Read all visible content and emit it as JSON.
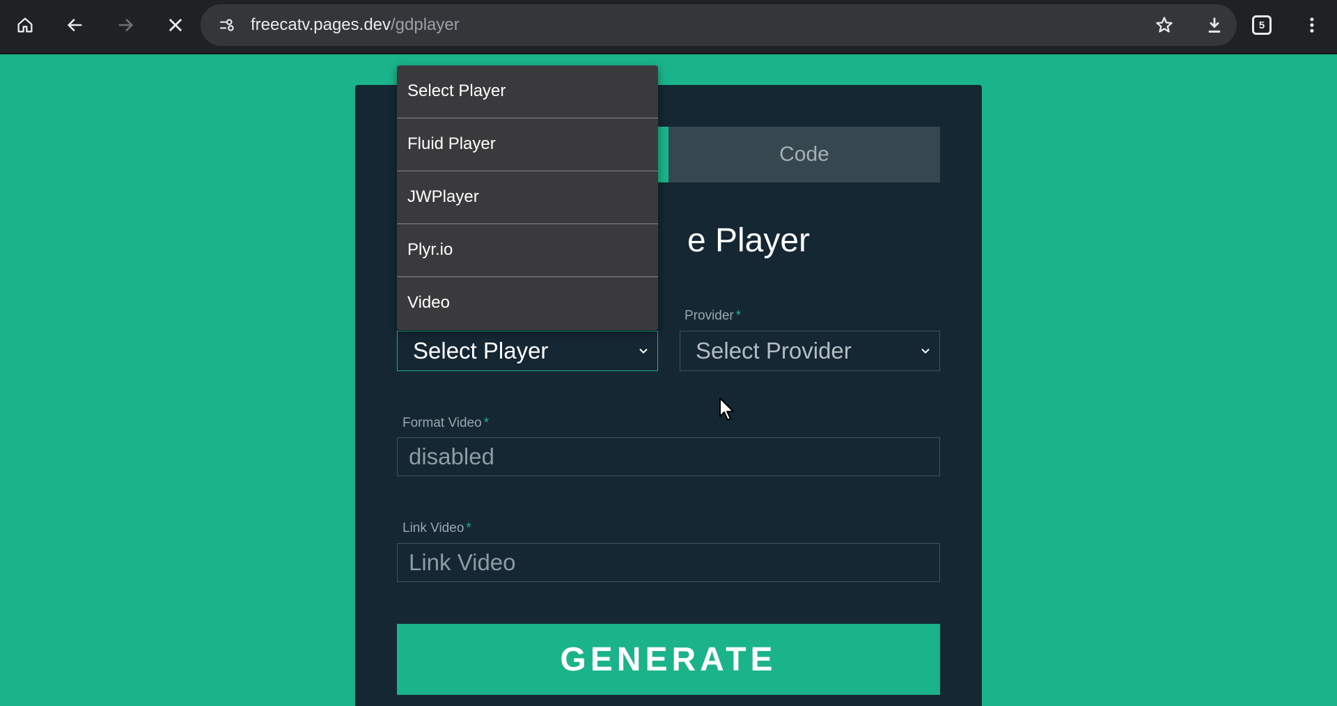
{
  "browser": {
    "url_host": "freecatv.pages.dev",
    "url_path": "/gdplayer",
    "tab_count": "5",
    "icons": [
      "home-icon",
      "back-icon",
      "forward-icon",
      "stop-icon",
      "site-info-icon",
      "bookmark-star-icon",
      "download-icon",
      "tab-count-icon",
      "menu-icon"
    ]
  },
  "tabs": {
    "code_label": "Code"
  },
  "title": "e Player",
  "player": {
    "selected": "Select Player",
    "options": [
      "Select Player",
      "Fluid Player",
      "JWPlayer",
      "Plyr.io",
      "Video"
    ]
  },
  "provider": {
    "label": "Provider",
    "required": "*",
    "selected": "Select Provider"
  },
  "format_video": {
    "label": "Format Video",
    "required": "*",
    "value": "disabled"
  },
  "link_video": {
    "label": "Link Video",
    "required": "*",
    "placeholder": "Link Video"
  },
  "generate_label": "GENERATE",
  "colors": {
    "accent": "#1bb38a",
    "card_bg": "#152733",
    "toolbar_bg": "#202124",
    "dropdown_bg": "#3a3a3c"
  }
}
